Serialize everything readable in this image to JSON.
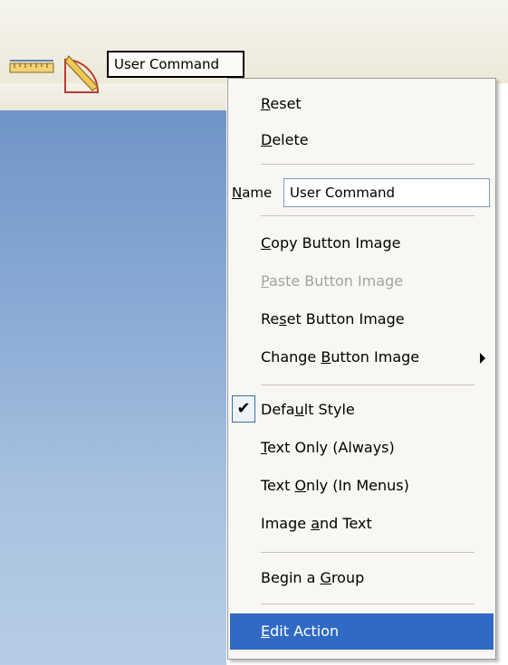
{
  "toolbar": {
    "ruler_icon": "ruler-icon",
    "protractor_icon": "protractor-icon",
    "user_command_button": "User Command"
  },
  "menu": {
    "reset": {
      "pre": "",
      "key": "R",
      "post": "eset"
    },
    "delete": {
      "pre": "",
      "key": "D",
      "post": "elete"
    },
    "name_label": {
      "pre": "",
      "key": "N",
      "post": "ame"
    },
    "name_value": "User Command",
    "copy_button_image": {
      "pre": "",
      "key": "C",
      "post": "opy Button Image"
    },
    "paste_button_image": {
      "pre": "",
      "key": "P",
      "post": "aste Button Image"
    },
    "reset_button_image": {
      "pre": "Re",
      "key": "s",
      "post": "et Button Image"
    },
    "change_button_image": {
      "pre": "Change ",
      "key": "B",
      "post": "utton Image"
    },
    "default_style": {
      "pre": "Defa",
      "key": "u",
      "post": "lt Style"
    },
    "default_style_checked": true,
    "text_only_always": {
      "pre": "",
      "key": "T",
      "post": "ext Only (Always)"
    },
    "text_only_menus": {
      "pre": "Text ",
      "key": "O",
      "post": "nly (In Menus)"
    },
    "image_and_text": {
      "pre": "Image ",
      "key": "a",
      "post": "nd Text"
    },
    "begin_group": {
      "pre": "Begin a ",
      "key": "G",
      "post": "roup"
    },
    "edit_action": {
      "pre": "",
      "key": "E",
      "post": "dit Action"
    },
    "highlight_color": "#316ac5"
  }
}
